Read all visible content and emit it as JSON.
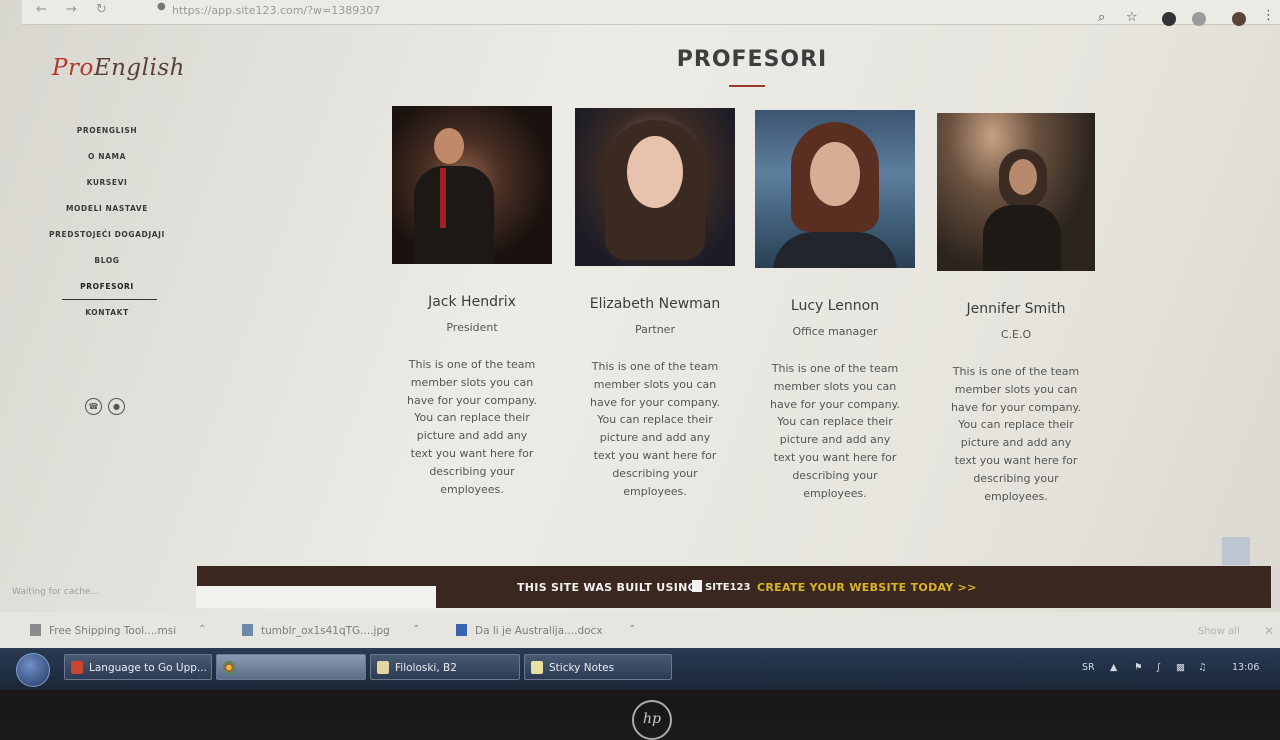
{
  "browser": {
    "url": "https://app.site123.com/?w=1389307"
  },
  "sidebar": {
    "logo_pro": "Pro",
    "logo_english": "English",
    "menu": [
      {
        "label": "PROENGLISH"
      },
      {
        "label": "O NAMA"
      },
      {
        "label": "KURSEVI"
      },
      {
        "label": "MODELI NASTAVE"
      },
      {
        "label": "PREDSTOJEĆI DOGADJAJI"
      },
      {
        "label": "BLOG"
      },
      {
        "label": "PROFESORI"
      },
      {
        "label": "KONTAKT"
      }
    ]
  },
  "main": {
    "title": "PROFESORI",
    "members": [
      {
        "name": "Jack Hendrix",
        "role": "President",
        "bio": "This is one of the team member slots you can have for your company. You can replace their picture and add any text you want here for describing your employees."
      },
      {
        "name": "Elizabeth Newman",
        "role": "Partner",
        "bio": "This is one of the team member slots you can have for your company. You can replace their picture and add any text you want here for describing your employees."
      },
      {
        "name": "Lucy Lennon",
        "role": "Office manager",
        "bio": "This is one of the team member slots you can have for your company. You can replace their picture and add any text you want here for describing your employees."
      },
      {
        "name": "Jennifer Smith",
        "role": "C.E.O",
        "bio": "This is one of the team member slots you can have for your company. You can replace their picture and add any text you want here for describing your employees."
      }
    ]
  },
  "footer": {
    "built_text": "THIS SITE WAS BUILT USING",
    "brand": "SITE123",
    "cta": "CREATE YOUR WEBSITE TODAY >>"
  },
  "status_text": "Waiting for cache...",
  "downloads": {
    "items": [
      {
        "name": "Free Shipping Tool....msi"
      },
      {
        "name": "tumblr_ox1s41qTG....jpg"
      },
      {
        "name": "Da li je Australija....docx"
      }
    ],
    "show_all": "Show all"
  },
  "taskbar": {
    "items": [
      {
        "label": "Language to Go Upp..."
      },
      {
        "label": ""
      },
      {
        "label": "Filoloski, B2"
      },
      {
        "label": "Sticky Notes"
      }
    ],
    "lang": "SR",
    "clock": "13:06"
  }
}
